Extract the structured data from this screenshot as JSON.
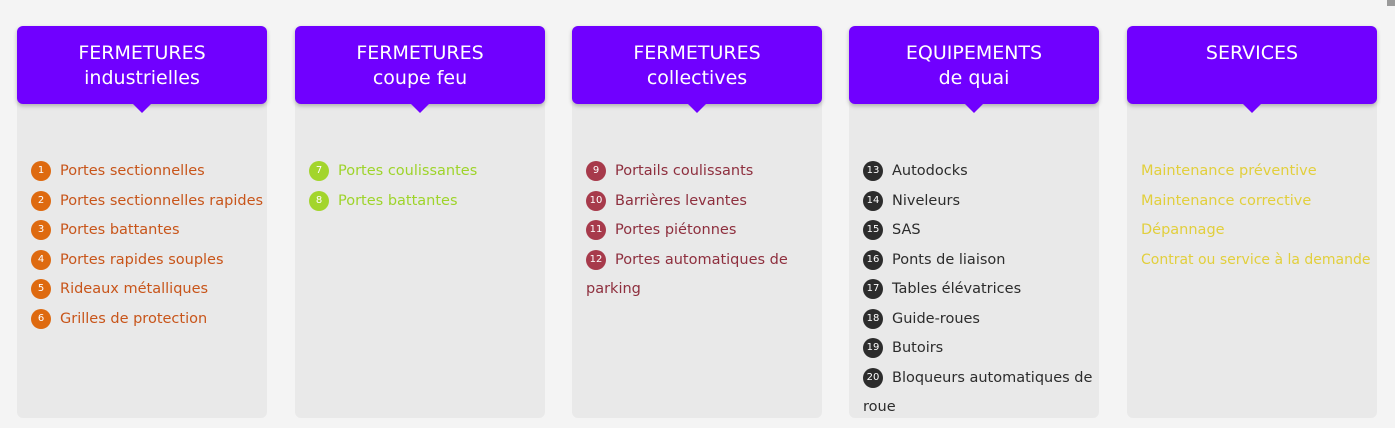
{
  "columns": [
    {
      "title_line1": "FERMETURES",
      "title_line2": "industrielles",
      "items": [
        {
          "num": "1",
          "label": "Portes sectionnelles"
        },
        {
          "num": "2",
          "label": "Portes sectionnelles rapides"
        },
        {
          "num": "3",
          "label": "Portes battantes"
        },
        {
          "num": "4",
          "label": "Portes rapides souples"
        },
        {
          "num": "5",
          "label": "Rideaux métalliques"
        },
        {
          "num": "6",
          "label": "Grilles de protection"
        }
      ]
    },
    {
      "title_line1": "FERMETURES",
      "title_line2": "coupe feu",
      "items": [
        {
          "num": "7",
          "label": "Portes coulissantes"
        },
        {
          "num": "8",
          "label": "Portes battantes"
        }
      ]
    },
    {
      "title_line1": "FERMETURES",
      "title_line2": "collectives",
      "items": [
        {
          "num": "9",
          "label": "Portails coulissants"
        },
        {
          "num": "10",
          "label": "Barrières levantes"
        },
        {
          "num": "11",
          "label": "Portes piétonnes"
        },
        {
          "num": "12",
          "label": "Portes automatiques de parking"
        }
      ]
    },
    {
      "title_line1": "EQUIPEMENTS",
      "title_line2": "de quai",
      "items": [
        {
          "num": "13",
          "label": "Autodocks"
        },
        {
          "num": "14",
          "label": "Niveleurs"
        },
        {
          "num": "15",
          "label": "SAS"
        },
        {
          "num": "16",
          "label": "Ponts de liaison"
        },
        {
          "num": "17",
          "label": "Tables élévatrices"
        },
        {
          "num": "18",
          "label": "Guide-roues"
        },
        {
          "num": "19",
          "label": "Butoirs"
        },
        {
          "num": "20",
          "label": "Bloqueurs automatiques de roue"
        }
      ]
    },
    {
      "title_line1": "SERVICES",
      "items": [
        {
          "label": "Maintenance préventive"
        },
        {
          "label": "Maintenance corrective"
        },
        {
          "label": "Dépannage"
        },
        {
          "label": "Contrat ou service à la demande"
        }
      ]
    }
  ],
  "colors": {
    "header_bg": "#7000ff",
    "industrielles": "#de6a10",
    "coupe_feu": "#a3d52c",
    "collectives": "#a73a4b",
    "quai": "#2c2c2c",
    "services": "#e2cf3c"
  }
}
